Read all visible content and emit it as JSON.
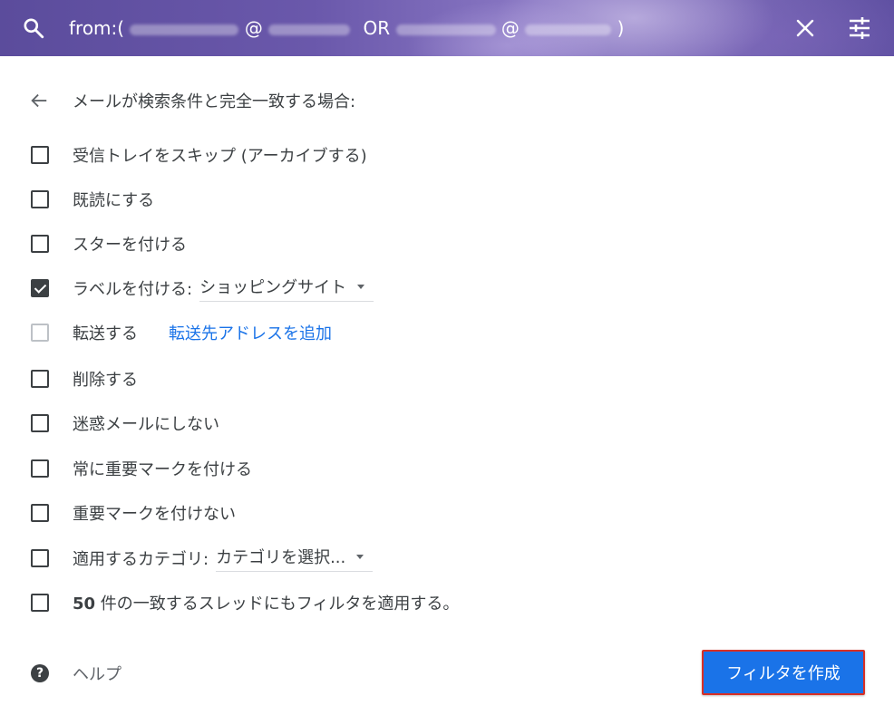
{
  "search": {
    "query_prefix": "from:(",
    "at1": "@",
    "or": "OR",
    "at2": "@",
    "query_suffix": ")"
  },
  "header": {
    "title": "メールが検索条件と完全一致する場合:"
  },
  "options": {
    "skip_inbox": {
      "label": "受信トレイをスキップ (アーカイブする)",
      "checked": false
    },
    "mark_read": {
      "label": "既読にする",
      "checked": false
    },
    "star": {
      "label": "スターを付ける",
      "checked": false
    },
    "apply_label": {
      "label": "ラベルを付ける:",
      "checked": true,
      "selected": "ショッピングサイト"
    },
    "forward": {
      "label": "転送する",
      "checked": false,
      "disabled": true,
      "link": "転送先アドレスを追加"
    },
    "delete": {
      "label": "削除する",
      "checked": false
    },
    "never_spam": {
      "label": "迷惑メールにしない",
      "checked": false
    },
    "always_important": {
      "label": "常に重要マークを付ける",
      "checked": false
    },
    "never_important": {
      "label": "重要マークを付けない",
      "checked": false
    },
    "category": {
      "label": "適用するカテゴリ:",
      "checked": false,
      "selected": "カテゴリを選択..."
    },
    "apply_existing": {
      "count": "50",
      "label": " 件の一致するスレッドにもフィルタを適用する。",
      "checked": false
    }
  },
  "footer": {
    "help": "ヘルプ",
    "help_icon": "?",
    "create_button": "フィルタを作成"
  }
}
